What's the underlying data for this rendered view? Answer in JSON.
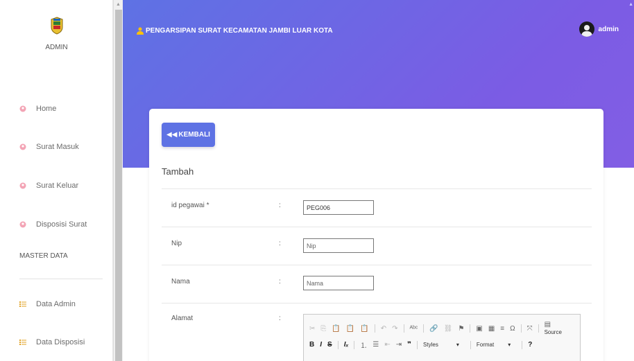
{
  "sidebar": {
    "logo_text": "ADMIN",
    "items": [
      {
        "label": "Home"
      },
      {
        "label": "Surat Masuk"
      },
      {
        "label": "Surat Keluar"
      },
      {
        "label": "Disposisi Surat"
      }
    ],
    "section_label": "MASTER DATA",
    "master_items": [
      {
        "label": "Data Admin"
      },
      {
        "label": "Data Disposisi"
      }
    ]
  },
  "header": {
    "title": "PENGARSIPAN SURAT KECAMATAN JAMBI LUAR KOTA",
    "user": "admin"
  },
  "card": {
    "back_label": "KEMBALI",
    "title": "Tambah",
    "rows": [
      {
        "label": "id pegawai *",
        "value": "PEG006",
        "placeholder": ""
      },
      {
        "label": "Nip",
        "value": "",
        "placeholder": "Nip"
      },
      {
        "label": "Nama",
        "value": "",
        "placeholder": "Nama"
      },
      {
        "label": "Alamat"
      }
    ],
    "colon": ":",
    "editor": {
      "source_label": "Source",
      "styles_label": "Styles",
      "format_label": "Format",
      "help_label": "?"
    }
  },
  "colors": {
    "primary": "#5e72e4",
    "header_end": "#825ee4",
    "sidebar_icon": "#f3a4b5"
  }
}
